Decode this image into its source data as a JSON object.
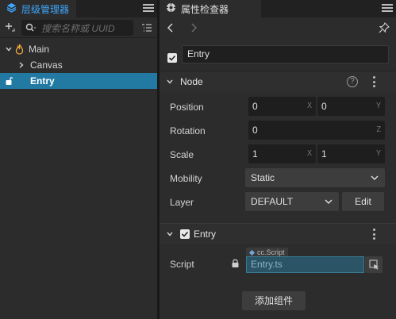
{
  "hierarchy": {
    "tab_title": "层级管理器",
    "search_placeholder": "搜索名称或 UUID",
    "nodes": [
      {
        "label": "Main"
      },
      {
        "label": "Canvas"
      },
      {
        "label": "Entry"
      }
    ]
  },
  "inspector": {
    "tab_title": "属性检查器",
    "node_name": "Entry",
    "node_section": {
      "title": "Node",
      "position": {
        "label": "Position",
        "x": "0",
        "x_axis": "X",
        "y": "0",
        "y_axis": "Y"
      },
      "rotation": {
        "label": "Rotation",
        "z": "0",
        "z_axis": "Z"
      },
      "scale": {
        "label": "Scale",
        "x": "1",
        "x_axis": "X",
        "y": "1",
        "y_axis": "Y"
      },
      "mobility": {
        "label": "Mobility",
        "value": "Static"
      },
      "layer": {
        "label": "Layer",
        "value": "DEFAULT",
        "edit_label": "Edit"
      }
    },
    "component_section": {
      "title": "Entry",
      "script_label": "Script",
      "script_tag": "cc.Script",
      "script_value": "Entry.ts"
    },
    "add_component_label": "添加组件"
  },
  "colors": {
    "accent": "#3ea7ff",
    "selected_row": "#227aa3",
    "script_field": "#2b5466"
  }
}
